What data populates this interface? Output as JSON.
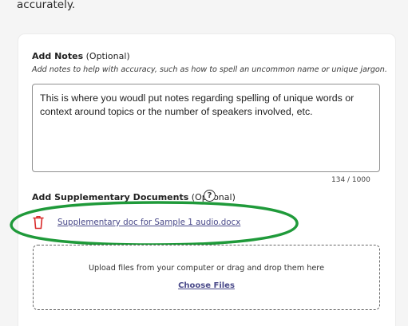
{
  "intro": {
    "trailing_text": "accurately."
  },
  "notes": {
    "heading": "Add Notes",
    "optional": " (Optional)",
    "hint": "Add notes to help with accuracy, such as how to spell an uncommon name or unique jargon.",
    "value": "This is where you woudl put notes regarding spelling of unique words or context around topics or the number of speakers involved, etc.",
    "char_count": "134 / 1000"
  },
  "supplementary": {
    "heading": "Add Supplementary Documents",
    "optional": " (Optional)",
    "help_icon_glyph": "?",
    "files": [
      {
        "name": "Supplementary doc for Sample 1 audio.docx",
        "delete_icon": "trash-icon"
      }
    ],
    "dropzone_text": "Upload files from your computer or drag and drop them here",
    "choose_files_label": "Choose Files"
  },
  "colors": {
    "delete_icon": "#d92b2b",
    "link": "#4a4a8a",
    "annotation_ellipse": "#1f9a3a"
  }
}
